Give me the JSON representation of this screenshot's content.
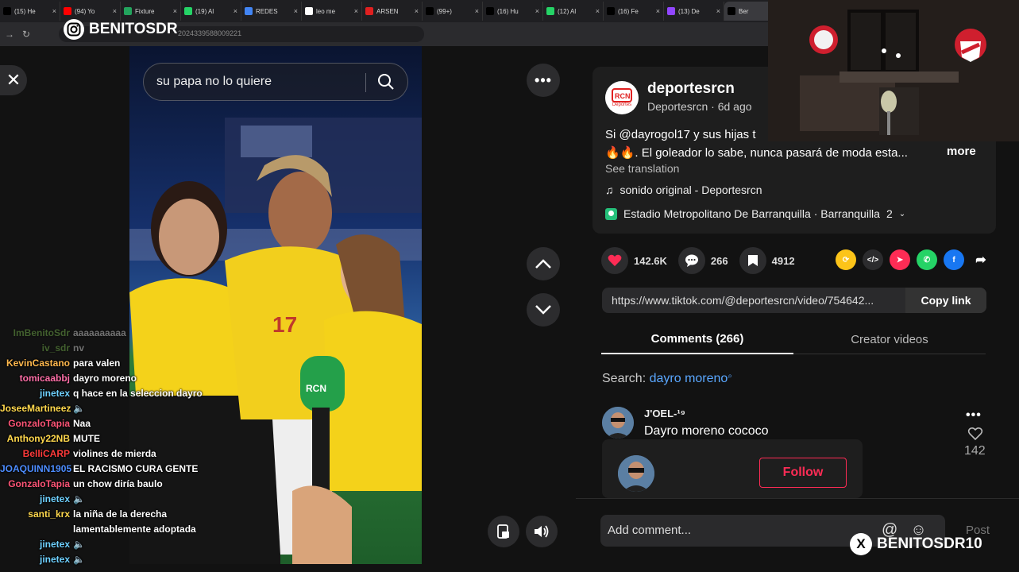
{
  "browser": {
    "tabs": [
      {
        "label": "(15) He",
        "icon": "x-icon",
        "color": "#000000"
      },
      {
        "label": "(94) Yo",
        "icon": "youtube-icon",
        "color": "#ff0000"
      },
      {
        "label": "Fixture",
        "icon": "fixture-icon",
        "color": "#23a45d"
      },
      {
        "label": "(19) Al",
        "icon": "whatsapp-icon",
        "color": "#25d366"
      },
      {
        "label": "REDES",
        "icon": "docs-icon",
        "color": "#4285f4"
      },
      {
        "label": "leo me",
        "icon": "google-icon",
        "color": "#ffffff"
      },
      {
        "label": "ARSEN",
        "icon": "news-icon",
        "color": "#e02020"
      },
      {
        "label": "(99+)",
        "icon": "tiktok-icon",
        "color": "#000000"
      },
      {
        "label": "(16) Hu",
        "icon": "x-icon",
        "color": "#000000"
      },
      {
        "label": "(12) Al",
        "icon": "whatsapp-icon",
        "color": "#25d366"
      },
      {
        "label": "(16) Fe",
        "icon": "x-icon",
        "color": "#000000"
      },
      {
        "label": "(13) De",
        "icon": "twitch-icon",
        "color": "#9146ff"
      },
      {
        "label": "Ber",
        "icon": "tiktok-icon",
        "color": "#000000"
      }
    ],
    "url": "2024339588009221"
  },
  "overlay": {
    "ig_handle": "BENITOSDR",
    "x_handle": "BENITOSDR10",
    "x_letter": "X"
  },
  "video": {
    "search_text": "su papa no lo quiere"
  },
  "post": {
    "account_name": "deportesrcn",
    "account_sub": "Deportesrcn · 6d ago",
    "avatar_text": "Deportes",
    "caption_line1": "Si @dayrogol17 y sus hijas t",
    "caption_line2": "🔥🔥. El goleador lo sabe, nunca pasará de moda esta...",
    "more_label": "more",
    "see_translation": "See translation",
    "music": "sonido original - Deportesrcn",
    "location": "Estadio Metropolitano De Barranquilla · Barranquilla",
    "location_count": "2"
  },
  "actions": {
    "likes": "142.6K",
    "comments": "266",
    "saves": "4912"
  },
  "share": {
    "link": "https://www.tiktok.com/@deportesrcn/video/754642...",
    "copy_label": "Copy link"
  },
  "tabs": {
    "comments": "Comments (266)",
    "creator": "Creator videos"
  },
  "comment_search": {
    "label": "Search:",
    "query": "dayro moreno"
  },
  "comment": {
    "user": "J'OEL-¹⁹",
    "text": "Dayro moreno cococo",
    "likes": "142"
  },
  "follow": {
    "label": "Follow"
  },
  "composer": {
    "placeholder": "Add comment...",
    "post_label": "Post"
  },
  "chat": [
    {
      "user": "ImBenitoSdr",
      "msg": "aaaaaaaaaa",
      "color": "#8bd45a",
      "faded": true
    },
    {
      "user": "iv_sdr",
      "msg": "nv",
      "color": "#8bd45a",
      "faded": true
    },
    {
      "user": "KevinCastano",
      "msg": "para valen",
      "color": "#ffb84d",
      "faded": false
    },
    {
      "user": "tomicaabbj",
      "msg": "dayro moreno",
      "color": "#ff6fa8",
      "faded": false
    },
    {
      "user": "jinetex",
      "msg": "q hace en la seleccion dayro",
      "color": "#6fd1ff",
      "faded": false
    },
    {
      "user": "JoseeMartineez",
      "msg": "🔈",
      "color": "#ffd84d",
      "faded": false
    },
    {
      "user": "GonzaloTapia",
      "msg": "Naa",
      "color": "#ff5577",
      "faded": false
    },
    {
      "user": "Anthony22NB",
      "msg": "MUTE",
      "color": "#ffd84d",
      "faded": false
    },
    {
      "user": "BelliCARP",
      "msg": "violines de mierda",
      "color": "#ff3b3b",
      "faded": false
    },
    {
      "user": "JOAQUINN1905",
      "msg": "EL RACISMO CURA GENTE",
      "color": "#4d8dff",
      "faded": false
    },
    {
      "user": "GonzaloTapia",
      "msg": "un chow diría baulo",
      "color": "#ff5577",
      "faded": false
    },
    {
      "user": "jinetex",
      "msg": "🔈",
      "color": "#6fd1ff",
      "faded": false
    },
    {
      "user": "santi_krx",
      "msg": "la niña de la derecha lamentablemente adoptada",
      "color": "#ffd84d",
      "faded": false
    },
    {
      "user": "jinetex",
      "msg": "🔈",
      "color": "#6fd1ff",
      "faded": false
    },
    {
      "user": "jinetex",
      "msg": "🔈",
      "color": "#6fd1ff",
      "faded": false
    }
  ],
  "colors": {
    "accent": "#fe2c55",
    "link": "#5aa7ff",
    "panel": "#121212"
  }
}
